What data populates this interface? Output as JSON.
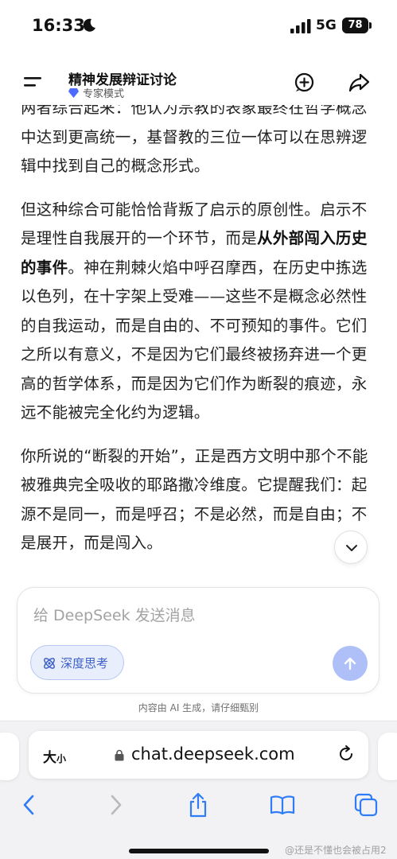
{
  "status_bar": {
    "time": "16:33",
    "network": "5G",
    "battery": "78"
  },
  "header": {
    "title": "精神发展辩证讨论",
    "mode_label": "专家模式",
    "accent_color": "#4d6bfe"
  },
  "content": {
    "paragraphs": [
      {
        "parts": [
          {
            "text": "两者综合起来：他认为宗教的表象最终在哲学概念中达到更高统一，基督教的三位一体可以在思辨逻辑中找到自己的概念形式。",
            "bold": false
          }
        ]
      },
      {
        "parts": [
          {
            "text": "但这种综合可能恰恰背叛了启示的原创性。启示不是理性自我展开的一个环节，而是",
            "bold": false
          },
          {
            "text": "从外部闯入历史的事件",
            "bold": true
          },
          {
            "text": "。神在荆棘火焰中呼召摩西，在历史中拣选以色列，在十字架上受难——这些不是概念必然性的自我运动，而是自由的、不可预知的事件。它们之所以有意义，不是因为它们最终被扬弃进一个更高的哲学体系，而是因为它们作为断裂的痕迹，永远不能被完全化约为逻辑。",
            "bold": false
          }
        ]
      },
      {
        "parts": [
          {
            "text": "你所说的“断裂的开始”，正是西方文明中那个不能被雅典完全吸收的耶路撒冷维度。它提醒我们：起源不是同一，而是呼召；不是必然，而是自由；不是展开，而是闯入。",
            "bold": false
          }
        ]
      }
    ]
  },
  "composer": {
    "placeholder": "给 DeepSeek 发送消息",
    "deep_think_label": "深度思考",
    "send_color": "#aec0f7"
  },
  "disclaimer": "内容由 AI 生成，请仔细甄别",
  "browser": {
    "text_size_big": "大",
    "text_size_small": "小",
    "url": "chat.deepseek.com",
    "accent_color": "#2f7cf6"
  },
  "watermark": "@还是不懂也会被占用2",
  "icons": [
    "moon-icon",
    "signal-icon",
    "menu-icon",
    "diamond-icon",
    "new-chat-icon",
    "share-icon",
    "chevron-down-icon",
    "atom-icon",
    "arrow-up-icon",
    "lock-icon",
    "reload-icon",
    "back-icon",
    "forward-icon",
    "share-sheet-icon",
    "bookmarks-icon",
    "tabs-icon"
  ]
}
